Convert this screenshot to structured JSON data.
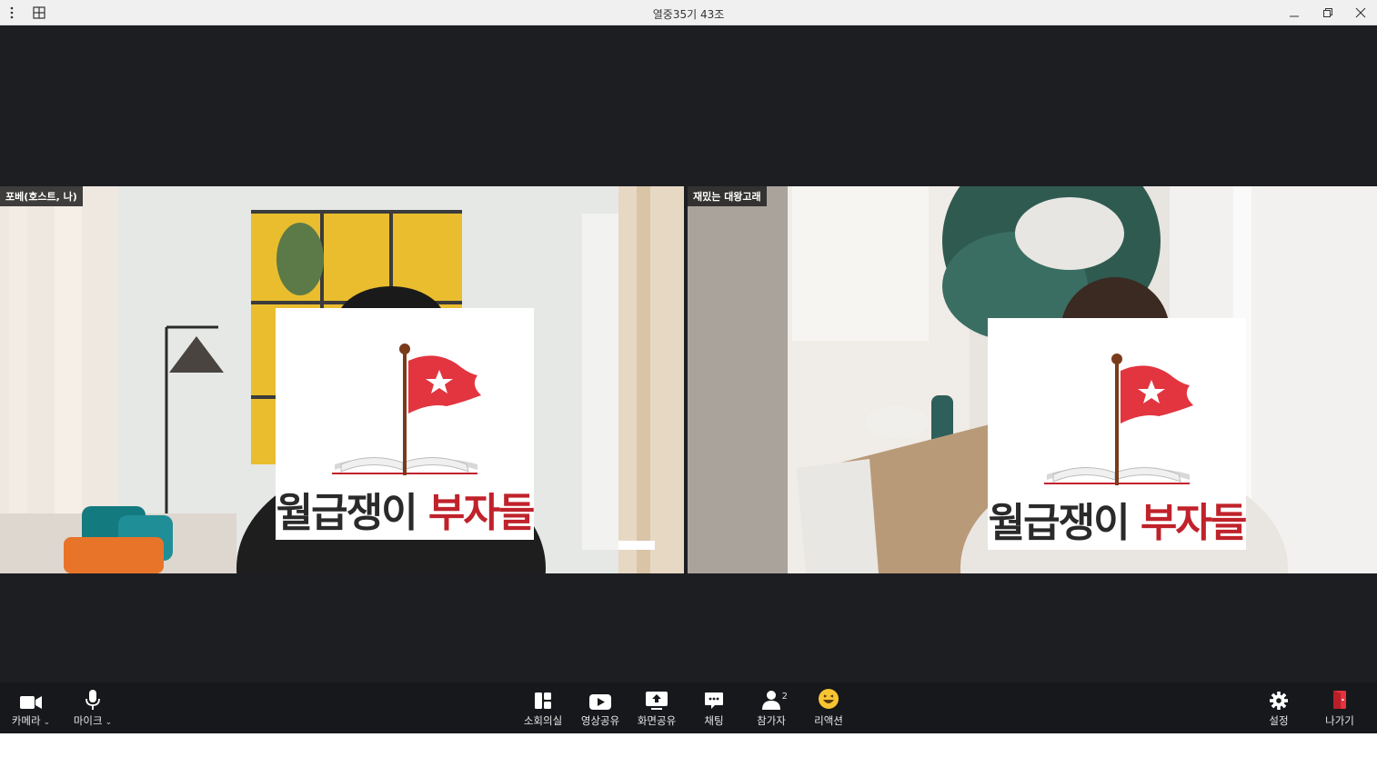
{
  "window": {
    "title": "열중35기 43조",
    "menu_icon": "more-vertical-icon",
    "layout_icon": "grid-icon",
    "minimize_icon": "minimize-icon",
    "restore_icon": "restore-icon",
    "close_icon": "close-icon"
  },
  "participants": [
    {
      "name": "포베(호스트, 나)",
      "logo_dark": "월급쟁이",
      "logo_red": "부자들"
    },
    {
      "name": "재밌는 대왕고래",
      "logo_dark": "월급쟁이",
      "logo_red": "부자들"
    }
  ],
  "toolbar": {
    "camera": "카메라",
    "mic": "마이크",
    "breakout": "소회의실",
    "video_share": "영상공유",
    "screen_share": "화면공유",
    "chat": "채팅",
    "participants": "참가자",
    "participants_count": "2",
    "reaction": "리액션",
    "settings": "설정",
    "leave": "나가기"
  },
  "colors": {
    "meeting_bg": "#1d1e22",
    "toolbar_bg": "#17181b",
    "brand_red": "#c0222b",
    "leave_red": "#e5333d"
  }
}
